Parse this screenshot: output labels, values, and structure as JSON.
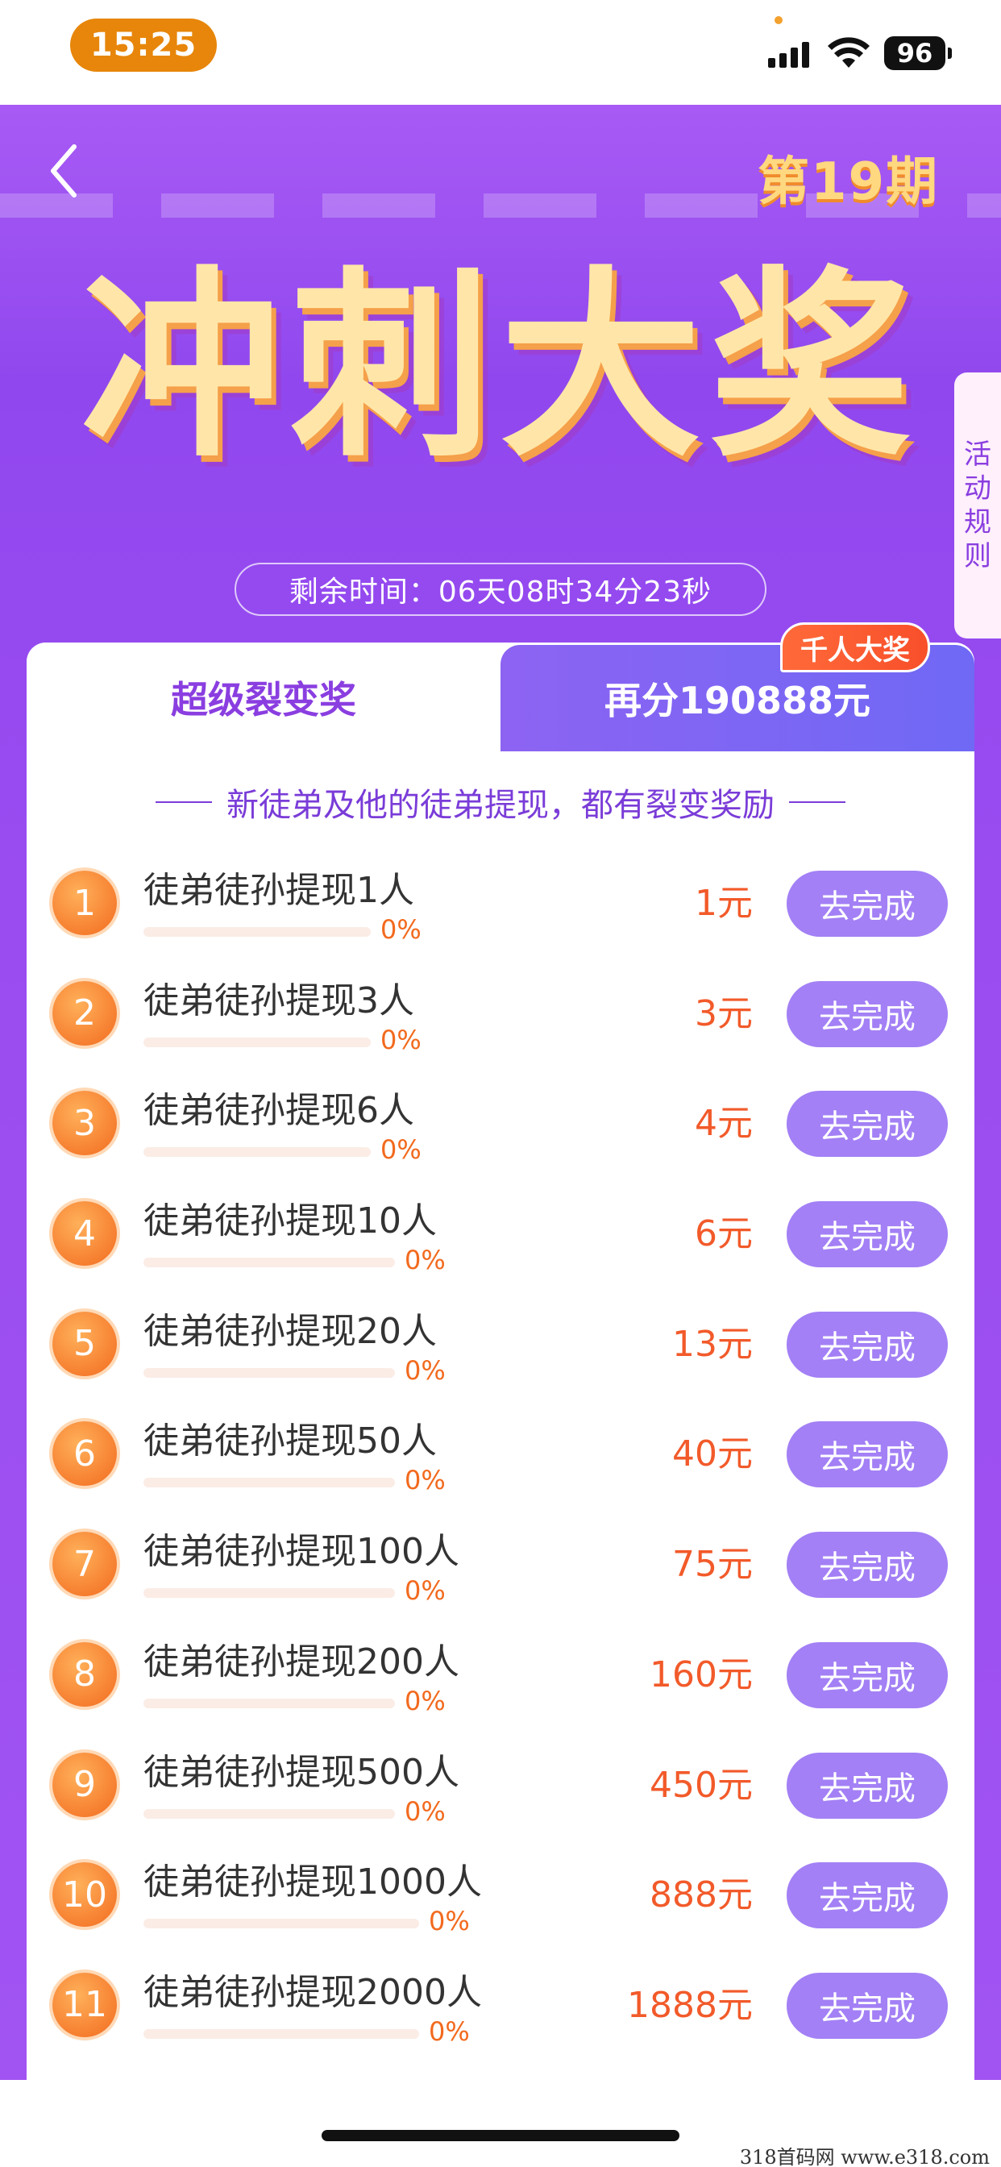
{
  "status_bar": {
    "time": "15:25",
    "battery": "96"
  },
  "header": {
    "issue": "第19期",
    "title": "冲刺大奖",
    "countdown": "剩余时间：06天08时34分23秒"
  },
  "rules_tab": {
    "chars": [
      "活",
      "动",
      "规",
      "则"
    ]
  },
  "tabs": {
    "left": "超级裂变奖",
    "right": "再分190888元",
    "badge": "千人大奖"
  },
  "subtitle": "新徒弟及他的徒弟提现，都有裂变奖励",
  "tasks": [
    {
      "num": "1",
      "label": "徒弟徒孙提现1人",
      "progress": "0%",
      "reward": "1元",
      "button": "去完成"
    },
    {
      "num": "2",
      "label": "徒弟徒孙提现3人",
      "progress": "0%",
      "reward": "3元",
      "button": "去完成"
    },
    {
      "num": "3",
      "label": "徒弟徒孙提现6人",
      "progress": "0%",
      "reward": "4元",
      "button": "去完成"
    },
    {
      "num": "4",
      "label": "徒弟徒孙提现10人",
      "progress": "0%",
      "reward": "6元",
      "button": "去完成"
    },
    {
      "num": "5",
      "label": "徒弟徒孙提现20人",
      "progress": "0%",
      "reward": "13元",
      "button": "去完成"
    },
    {
      "num": "6",
      "label": "徒弟徒孙提现50人",
      "progress": "0%",
      "reward": "40元",
      "button": "去完成"
    },
    {
      "num": "7",
      "label": "徒弟徒孙提现100人",
      "progress": "0%",
      "reward": "75元",
      "button": "去完成"
    },
    {
      "num": "8",
      "label": "徒弟徒孙提现200人",
      "progress": "0%",
      "reward": "160元",
      "button": "去完成"
    },
    {
      "num": "9",
      "label": "徒弟徒孙提现500人",
      "progress": "0%",
      "reward": "450元",
      "button": "去完成"
    },
    {
      "num": "10",
      "label": "徒弟徒孙提现1000人",
      "progress": "0%",
      "reward": "888元",
      "button": "去完成"
    },
    {
      "num": "11",
      "label": "徒弟徒孙提现2000人",
      "progress": "0%",
      "reward": "1888元",
      "button": "去完成"
    }
  ],
  "watermark": "318首码网  www.e318.com"
}
